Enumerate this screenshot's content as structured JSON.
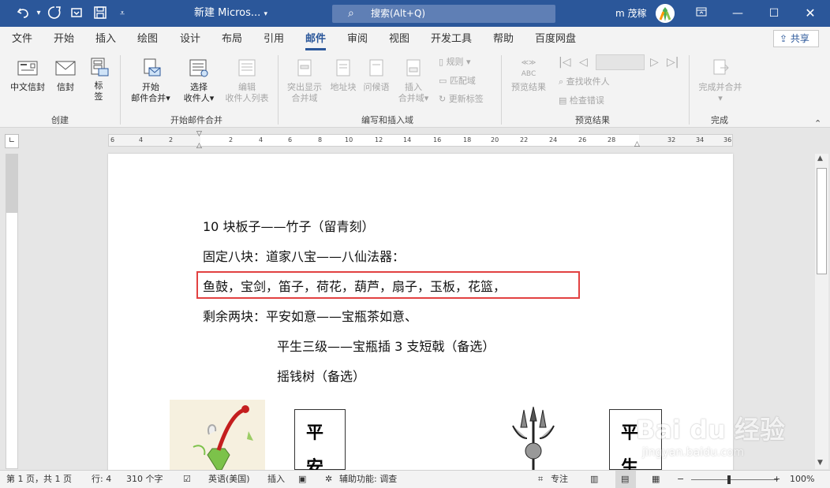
{
  "titlebar": {
    "doc_title": "新建 Micros...",
    "search_text": "搜索(Alt+Q)",
    "user_name": "m 茂稼"
  },
  "tabs": [
    "文件",
    "开始",
    "插入",
    "绘图",
    "设计",
    "布局",
    "引用",
    "邮件",
    "审阅",
    "视图",
    "开发工具",
    "帮助",
    "百度网盘"
  ],
  "share_label": "共享",
  "ribbon": {
    "groups": [
      "创建",
      "开始邮件合并",
      "编写和插入域",
      "预览结果",
      "完成"
    ],
    "create": {
      "chinese_envelope": "中文信封",
      "envelope": "信封",
      "labels": "标\n签"
    },
    "start": {
      "start_merge_1": "开始",
      "start_merge_2": "邮件合并",
      "select_1": "选择",
      "select_2": "收件人",
      "edit_1": "编辑",
      "edit_2": "收件人列表"
    },
    "write": {
      "highlight_1": "突出显示",
      "highlight_2": "合并域",
      "address": "地址块",
      "greeting": "问候语",
      "insert_1": "插入",
      "insert_2": "合并域",
      "rules": "规则",
      "match": "匹配域",
      "update": "更新标签"
    },
    "preview": {
      "abc": "ABC",
      "preview_results": "预览结果",
      "find": "查找收件人",
      "check": "检查错误"
    },
    "finish": {
      "finish_1": "完成并合并"
    }
  },
  "ruler_numbers": [
    "6",
    "4",
    "2",
    "2",
    "4",
    "6",
    "8",
    "10",
    "12",
    "14",
    "16",
    "18",
    "20",
    "22",
    "24",
    "26",
    "28",
    "32",
    "34",
    "36"
  ],
  "document": {
    "lines": [
      "10 块板子——竹子（留青刻）",
      "固定八块：道家八宝——八仙法器：",
      "鱼鼓，宝剑，笛子，荷花，葫芦，扇子，玉板，花篮，",
      "剩余两块：平安如意——宝瓶茶如意、",
      "平生三级——宝瓶插 3 支短戟（备选）",
      "摇钱树（备选）"
    ],
    "card1": [
      "平",
      "安"
    ],
    "card2": [
      "平",
      "生"
    ]
  },
  "statusbar": {
    "page": "第 1 页，共 1 页",
    "line": "行: 4",
    "chars": "310 个字",
    "language": "英语(美国)",
    "insert": "插入",
    "accessibility": "辅助功能: 调查",
    "focus": "专注",
    "zoom": "100%"
  },
  "watermark": {
    "brand": "Bai du 经验",
    "url": "jingyan.baidu.com"
  },
  "colors": {
    "title_bar": "#2b579a",
    "highlight_box": "#e24141",
    "ribbon": "#f3f3f3"
  }
}
